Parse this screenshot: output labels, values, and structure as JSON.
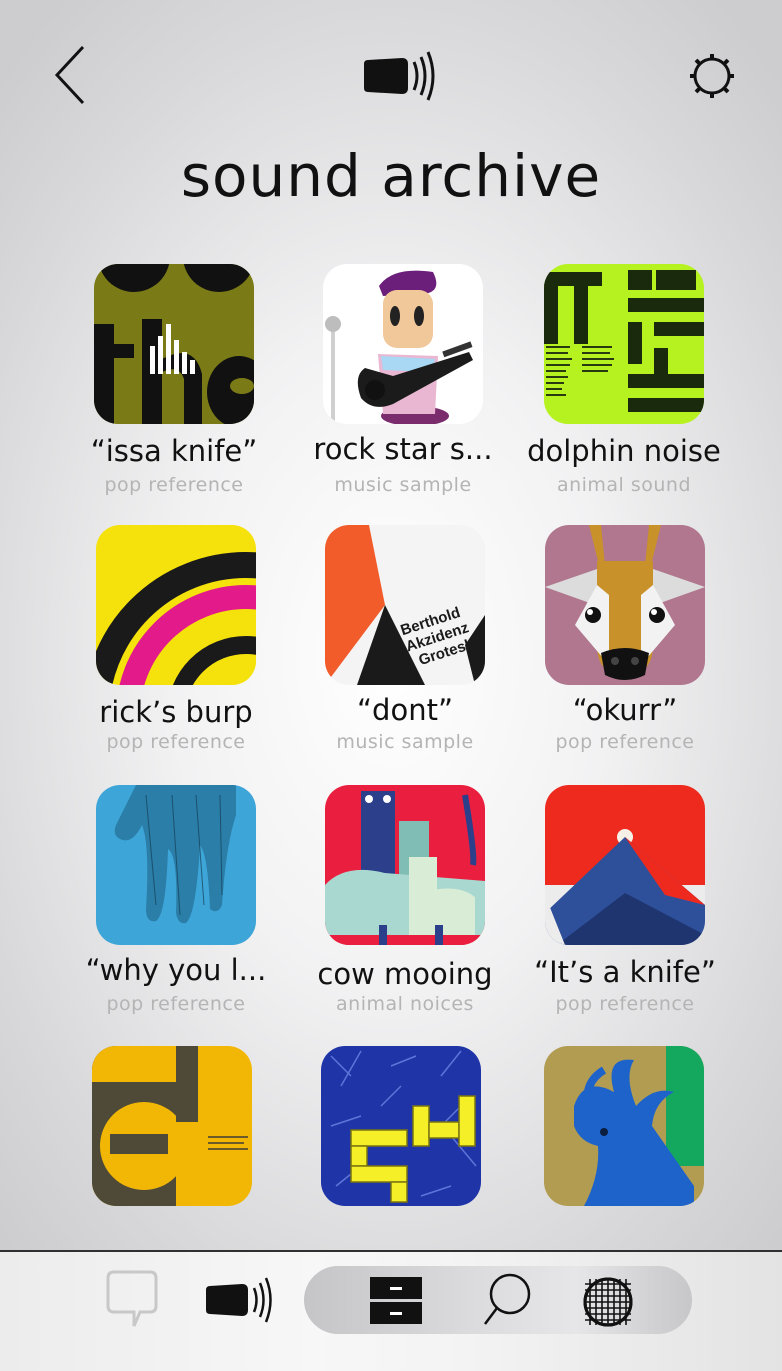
{
  "header": {
    "back_icon": "chevron-left-icon",
    "center_icon": "speaker-icon",
    "settings_icon": "gear-icon"
  },
  "title": "sound archive",
  "sounds": [
    {
      "name": "“issa knife”",
      "category": "pop reference",
      "art": "olive typography poster with playing indicator"
    },
    {
      "name": "rock star s...",
      "category": "music sample",
      "art": "cartoon guitarist"
    },
    {
      "name": "dolphin noise",
      "category": "animal sound",
      "art": "lime green typography poster"
    },
    {
      "name": "rick’s burp",
      "category": "pop reference",
      "art": "yellow and magenta arcs"
    },
    {
      "name": "“dont”",
      "category": "music sample",
      "art": "Berthold Akzidenz Grotesk poster"
    },
    {
      "name": "“okurr”",
      "category": "pop reference",
      "art": "cow face"
    },
    {
      "name": "“why you l...",
      "category": "pop reference",
      "art": "blue hand"
    },
    {
      "name": "cow mooing",
      "category": "animal noices",
      "art": "stacked animals"
    },
    {
      "name": "“It’s a knife”",
      "category": "pop reference",
      "art": "red sun over mountain"
    },
    {
      "name": "",
      "category": "",
      "art": "yellow circle poster"
    },
    {
      "name": "",
      "category": "",
      "art": "blue grass with yellow blocks"
    },
    {
      "name": "",
      "category": "",
      "art": "blue antelope"
    }
  ],
  "art_text": {
    "akzidenz": [
      "Berthold",
      "Akzidenz",
      "Grotesk"
    ]
  },
  "bottom_nav": {
    "items": [
      "chat-bubble-icon",
      "speaker-icon",
      "archive-drawer-icon",
      "search-icon",
      "globe-icon"
    ],
    "active": "archive-drawer-icon"
  },
  "colors": {
    "text": "#111111",
    "subtext": "#b4b4b4",
    "lime": "#b6f21f",
    "olive": "#7a7a16"
  }
}
